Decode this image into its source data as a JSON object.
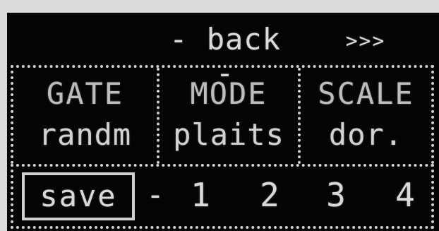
{
  "topbar": {
    "back_label": "- back -",
    "next_label": ">>>"
  },
  "params": [
    {
      "label": "GATE",
      "value": "randm"
    },
    {
      "label": "MODE",
      "value": "plaits"
    },
    {
      "label": "SCALE",
      "value": "dor."
    }
  ],
  "bottom": {
    "save_label": "save",
    "separator": "-",
    "slots": [
      "1",
      "2",
      "3",
      "4"
    ]
  },
  "colors": {
    "screen_bg": "#050505",
    "pixel_on": "#d9d9d9"
  }
}
